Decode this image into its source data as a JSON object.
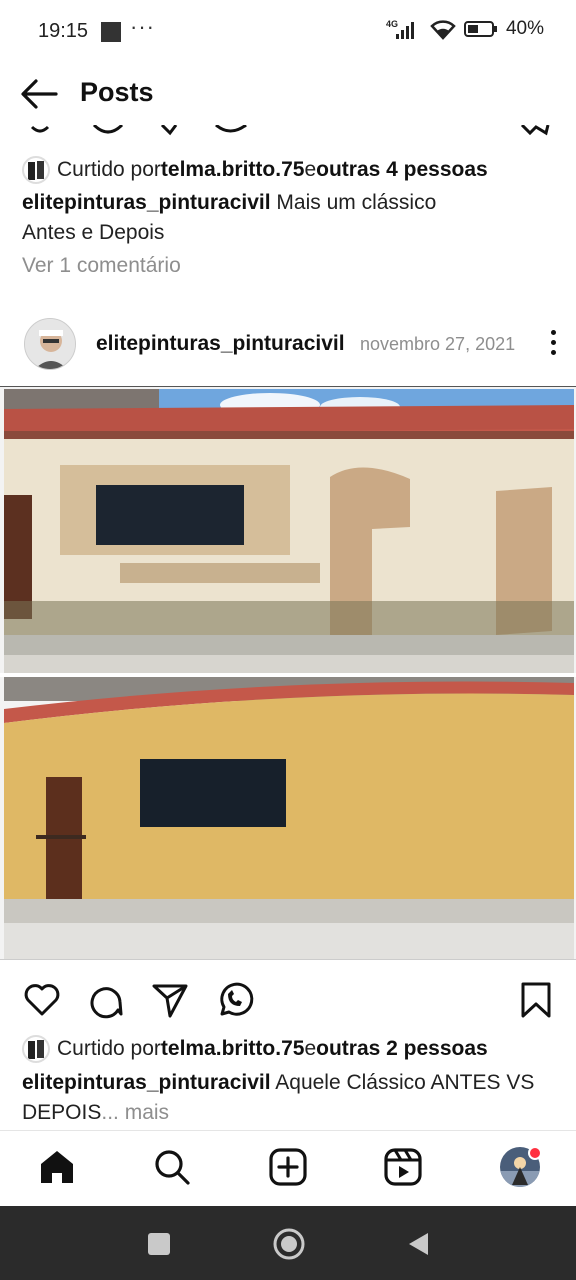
{
  "status_bar": {
    "time": "19:15",
    "dots": "···",
    "network": "4G",
    "battery": "40%"
  },
  "header": {
    "title": "Posts"
  },
  "prev_post": {
    "liked_by_prefix": "Curtido por ",
    "liked_by_user": "telma.britto.75",
    "liked_by_mid": " e ",
    "liked_by_others": "outras 4 pessoas",
    "caption_user": "elitepinturas_pinturacivil",
    "caption_line1": " Mais um clássico",
    "caption_line2": "Antes e Depois",
    "view_comments": "Ver 1 comentário"
  },
  "post": {
    "username": "elitepinturas_pinturacivil",
    "date": "novembro 27, 2021",
    "liked_by_prefix": "Curtido por ",
    "liked_by_user": "telma.britto.75",
    "liked_by_mid": " e ",
    "liked_by_others": "outras 2 pessoas",
    "caption_user": "elitepinturas_pinturacivil",
    "caption_text": " Aquele Clássico ANTES VS DEPOIS",
    "caption_more": "... mais"
  },
  "colors": {
    "accent_notification": "#ff3040",
    "wall_before": "#ece3cf",
    "wall_after": "#dfb865",
    "roof": "#c4584a",
    "sky": "#6fa6de"
  },
  "icons": {
    "actions": [
      "heart-icon",
      "comment-icon",
      "share-icon",
      "whatsapp-icon",
      "bookmark-icon"
    ],
    "nav": [
      "home-icon",
      "search-icon",
      "create-icon",
      "reels-icon",
      "profile-avatar"
    ]
  }
}
